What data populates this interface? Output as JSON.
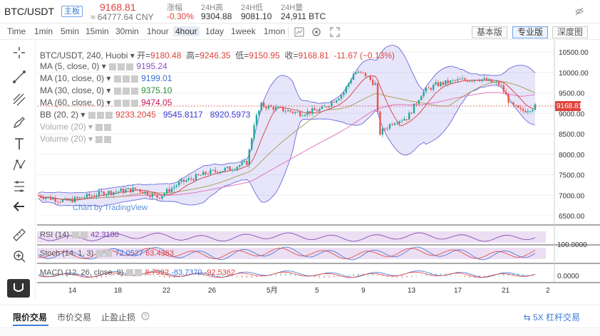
{
  "ticker": {
    "pair": "BTC/USDT",
    "tag": "主板",
    "price": "9168.81",
    "cny": "≈ 64777.64 CNY",
    "change_label": "涨幅",
    "change_value": "-0.30%",
    "high_label": "24H高",
    "high_value": "9304.88",
    "low_label": "24H低",
    "low_value": "9081.10",
    "vol_label": "24H量",
    "vol_value": "24,911 BTC"
  },
  "toolbar": {
    "timeframes": [
      "Time",
      "1min",
      "5min",
      "15min",
      "30min",
      "1hour",
      "4hour",
      "1day",
      "1week",
      "1mon"
    ],
    "active_timeframe": "4hour",
    "versions": [
      "基本版",
      "专业版",
      "深度图"
    ],
    "active_version": "专业版"
  },
  "legend": {
    "ohlc": {
      "symbol": "BTC/USDT, 240, Huobi",
      "open_label": "开=",
      "open": "9180.48",
      "high_label": "高=",
      "high": "9246.35",
      "low_label": "低=",
      "low": "9150.95",
      "close_label": "收=",
      "close": "9168.81",
      "change": "-11.67 (−0.13%)"
    },
    "indicators": [
      {
        "name": "MA (5, close, 0)",
        "values": [
          "9195.24"
        ],
        "colors": [
          "#8a4fc9"
        ]
      },
      {
        "name": "MA (10, close, 0)",
        "values": [
          "9199.01"
        ],
        "colors": [
          "#3a6fd8"
        ]
      },
      {
        "name": "MA (30, close, 0)",
        "values": [
          "9375.10"
        ],
        "colors": [
          "#2e8b3c"
        ]
      },
      {
        "name": "MA (60, close, 0)",
        "values": [
          "9474.05"
        ],
        "colors": [
          "#c2185b"
        ]
      },
      {
        "name": "BB (20, 2)",
        "values": [
          "9233.2045",
          "9545.8117",
          "8920.5973"
        ],
        "colors": [
          "#e0433d",
          "#3a3ad8",
          "#3a3ad8"
        ]
      },
      {
        "name": "Volume (20)",
        "values": [],
        "colors": []
      },
      {
        "name": "Volume (20)",
        "values": [],
        "colors": []
      }
    ],
    "watermark": "Chart by TradingView"
  },
  "price_axis": {
    "ticks": [
      "10500.00",
      "10000.00",
      "9500.00",
      "9000.00",
      "8500.00",
      "8000.00",
      "7500.00",
      "7000.00",
      "6500.00"
    ],
    "current": "9168.81"
  },
  "rsi": {
    "label": "RSI (14)",
    "value": "42.3180",
    "axis": "100.0000"
  },
  "stoch": {
    "label": "Stoch (14, 1, 3)",
    "k": "72.0527",
    "d": "63.4363"
  },
  "macd": {
    "label": "MACD (12, 26, close, 9)",
    "values": [
      "8.7992",
      "-83.7370",
      "-92.5362"
    ],
    "axis": "0.0000"
  },
  "time_axis": [
    "14",
    "18",
    "22",
    "26",
    "5月",
    "5",
    "9",
    "13",
    "17",
    "21",
    "2"
  ],
  "trade": {
    "tabs": [
      "限价交易",
      "市价交易",
      "止盈止损"
    ],
    "active_tab": "限价交易",
    "leverage": "5X 杠杆交易"
  },
  "colors": {
    "up": "#26a69a",
    "down": "#ef5350",
    "accent": "#3d7bd9"
  }
}
